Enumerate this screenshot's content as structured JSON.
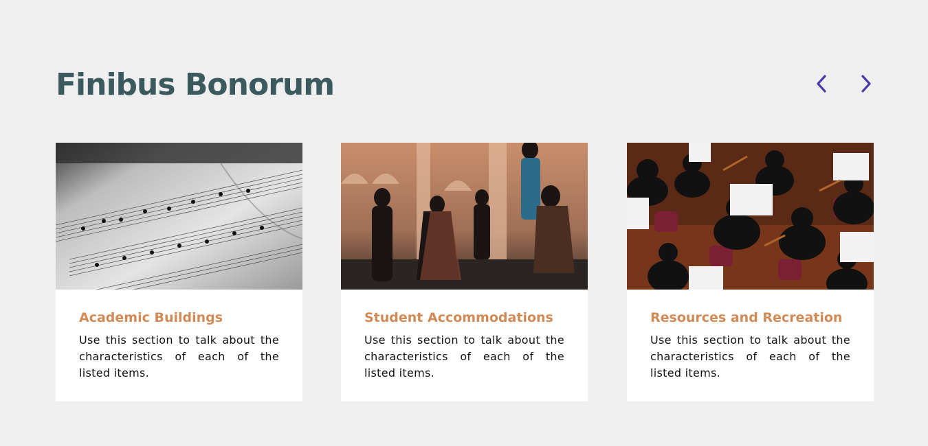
{
  "section": {
    "title": "Finibus Bonorum"
  },
  "nav": {
    "prev_icon": "chevron-left-icon",
    "next_icon": "chevron-right-icon",
    "accent_color": "#4a3aa8"
  },
  "cards": [
    {
      "image": "sheet-music-photo",
      "title": "Academic Buildings",
      "text": "Use this section to talk about the characteristics of each of the listed items."
    },
    {
      "image": "street-musicians-photo",
      "title": "Student Accommodations",
      "text": "Use this section to talk about the characteristics of each of the listed items."
    },
    {
      "image": "orchestra-photo",
      "title": "Resources and Recreation",
      "text": "Use this section to talk about the characteristics of each of the listed items."
    }
  ],
  "colors": {
    "background": "#efefef",
    "title": "#3b5a5e",
    "card_title": "#d08a55",
    "card_background": "#ffffff"
  }
}
